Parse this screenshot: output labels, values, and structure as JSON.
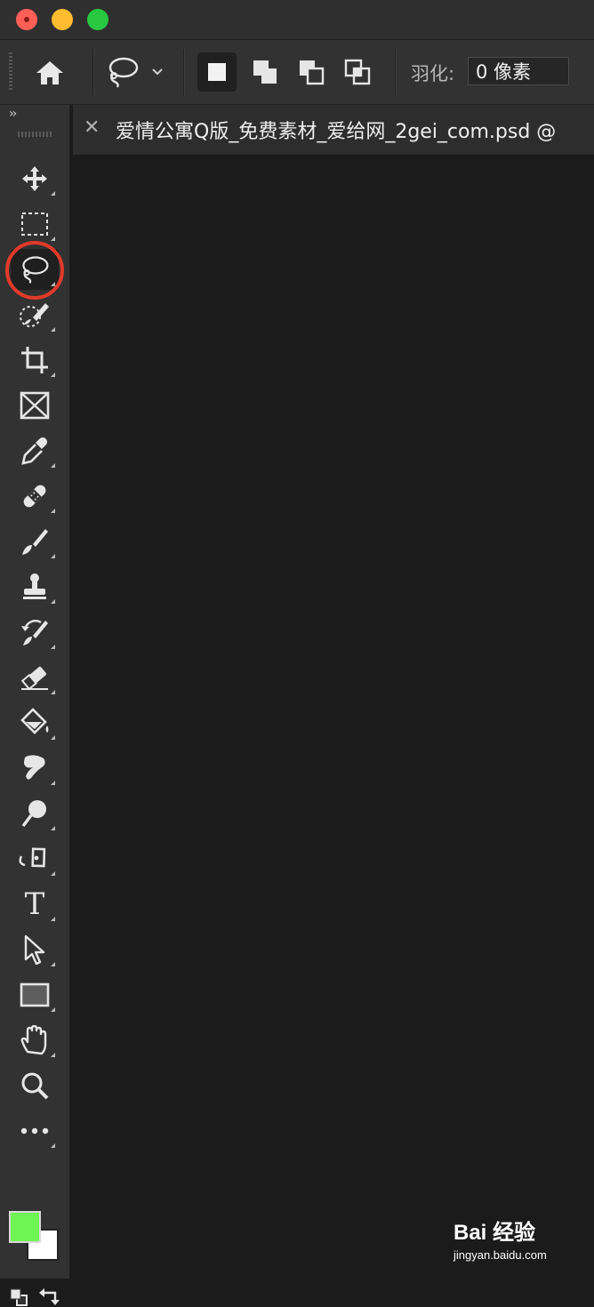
{
  "window": {
    "controls": [
      "close",
      "minimize",
      "zoom"
    ]
  },
  "options_bar": {
    "home_icon": "home-icon",
    "tool_preset_icon": "lasso-icon",
    "selection_modes": [
      "new-selection-icon",
      "add-to-selection-icon",
      "subtract-from-selection-icon",
      "intersect-selection-icon"
    ],
    "feather_label": "羽化:",
    "feather_value": "0 像素"
  },
  "toolbar": {
    "collapse_label": "››",
    "active_tool": "lasso-tool",
    "tools": [
      "move-icon",
      "rectangular-marquee-icon",
      "lasso-icon",
      "quick-selection-icon",
      "crop-icon",
      "frame-icon",
      "eyedropper-icon",
      "healing-brush-icon",
      "brush-icon",
      "clone-stamp-icon",
      "history-brush-icon",
      "eraser-icon",
      "paint-bucket-icon",
      "smudge-icon",
      "dodge-icon",
      "pen-icon",
      "type-icon",
      "path-selection-icon",
      "rectangle-icon",
      "hand-icon",
      "zoom-icon",
      "more-tools-icon"
    ],
    "type_tool_glyph": "T",
    "foreground_color": "#6ff553",
    "background_color": "#ffffff",
    "highlight_color": "#e23a2a"
  },
  "document": {
    "tab_title": "爱情公寓Q版_免费素材_爱给网_2gei_com.psd @"
  },
  "watermark": {
    "brand": "Bai 经验",
    "url": "jingyan.baidu.com"
  }
}
